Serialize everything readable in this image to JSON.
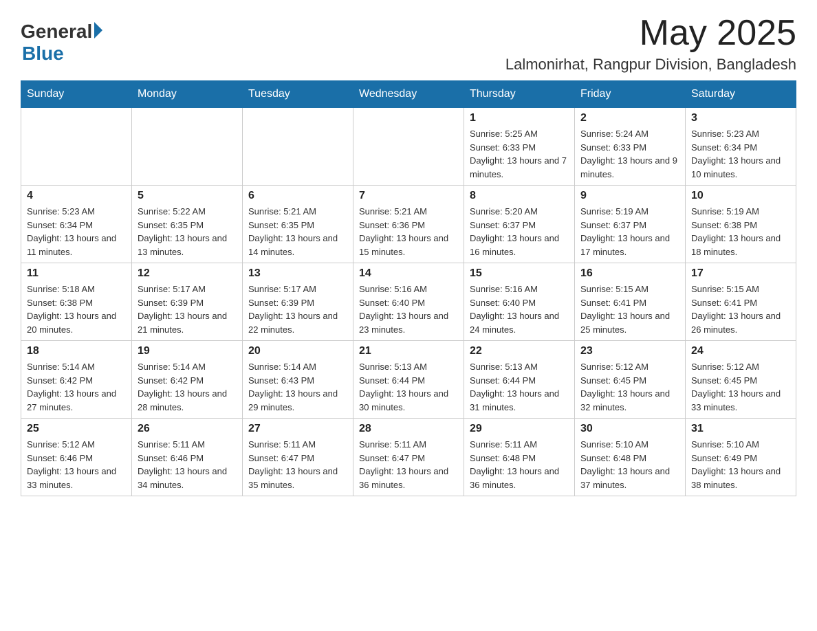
{
  "header": {
    "logo_general": "General",
    "logo_blue": "Blue",
    "month": "May 2025",
    "location": "Lalmonirhat, Rangpur Division, Bangladesh"
  },
  "weekdays": [
    "Sunday",
    "Monday",
    "Tuesday",
    "Wednesday",
    "Thursday",
    "Friday",
    "Saturday"
  ],
  "weeks": [
    [
      {
        "day": "",
        "info": ""
      },
      {
        "day": "",
        "info": ""
      },
      {
        "day": "",
        "info": ""
      },
      {
        "day": "",
        "info": ""
      },
      {
        "day": "1",
        "info": "Sunrise: 5:25 AM\nSunset: 6:33 PM\nDaylight: 13 hours and 7 minutes."
      },
      {
        "day": "2",
        "info": "Sunrise: 5:24 AM\nSunset: 6:33 PM\nDaylight: 13 hours and 9 minutes."
      },
      {
        "day": "3",
        "info": "Sunrise: 5:23 AM\nSunset: 6:34 PM\nDaylight: 13 hours and 10 minutes."
      }
    ],
    [
      {
        "day": "4",
        "info": "Sunrise: 5:23 AM\nSunset: 6:34 PM\nDaylight: 13 hours and 11 minutes."
      },
      {
        "day": "5",
        "info": "Sunrise: 5:22 AM\nSunset: 6:35 PM\nDaylight: 13 hours and 13 minutes."
      },
      {
        "day": "6",
        "info": "Sunrise: 5:21 AM\nSunset: 6:35 PM\nDaylight: 13 hours and 14 minutes."
      },
      {
        "day": "7",
        "info": "Sunrise: 5:21 AM\nSunset: 6:36 PM\nDaylight: 13 hours and 15 minutes."
      },
      {
        "day": "8",
        "info": "Sunrise: 5:20 AM\nSunset: 6:37 PM\nDaylight: 13 hours and 16 minutes."
      },
      {
        "day": "9",
        "info": "Sunrise: 5:19 AM\nSunset: 6:37 PM\nDaylight: 13 hours and 17 minutes."
      },
      {
        "day": "10",
        "info": "Sunrise: 5:19 AM\nSunset: 6:38 PM\nDaylight: 13 hours and 18 minutes."
      }
    ],
    [
      {
        "day": "11",
        "info": "Sunrise: 5:18 AM\nSunset: 6:38 PM\nDaylight: 13 hours and 20 minutes."
      },
      {
        "day": "12",
        "info": "Sunrise: 5:17 AM\nSunset: 6:39 PM\nDaylight: 13 hours and 21 minutes."
      },
      {
        "day": "13",
        "info": "Sunrise: 5:17 AM\nSunset: 6:39 PM\nDaylight: 13 hours and 22 minutes."
      },
      {
        "day": "14",
        "info": "Sunrise: 5:16 AM\nSunset: 6:40 PM\nDaylight: 13 hours and 23 minutes."
      },
      {
        "day": "15",
        "info": "Sunrise: 5:16 AM\nSunset: 6:40 PM\nDaylight: 13 hours and 24 minutes."
      },
      {
        "day": "16",
        "info": "Sunrise: 5:15 AM\nSunset: 6:41 PM\nDaylight: 13 hours and 25 minutes."
      },
      {
        "day": "17",
        "info": "Sunrise: 5:15 AM\nSunset: 6:41 PM\nDaylight: 13 hours and 26 minutes."
      }
    ],
    [
      {
        "day": "18",
        "info": "Sunrise: 5:14 AM\nSunset: 6:42 PM\nDaylight: 13 hours and 27 minutes."
      },
      {
        "day": "19",
        "info": "Sunrise: 5:14 AM\nSunset: 6:42 PM\nDaylight: 13 hours and 28 minutes."
      },
      {
        "day": "20",
        "info": "Sunrise: 5:14 AM\nSunset: 6:43 PM\nDaylight: 13 hours and 29 minutes."
      },
      {
        "day": "21",
        "info": "Sunrise: 5:13 AM\nSunset: 6:44 PM\nDaylight: 13 hours and 30 minutes."
      },
      {
        "day": "22",
        "info": "Sunrise: 5:13 AM\nSunset: 6:44 PM\nDaylight: 13 hours and 31 minutes."
      },
      {
        "day": "23",
        "info": "Sunrise: 5:12 AM\nSunset: 6:45 PM\nDaylight: 13 hours and 32 minutes."
      },
      {
        "day": "24",
        "info": "Sunrise: 5:12 AM\nSunset: 6:45 PM\nDaylight: 13 hours and 33 minutes."
      }
    ],
    [
      {
        "day": "25",
        "info": "Sunrise: 5:12 AM\nSunset: 6:46 PM\nDaylight: 13 hours and 33 minutes."
      },
      {
        "day": "26",
        "info": "Sunrise: 5:11 AM\nSunset: 6:46 PM\nDaylight: 13 hours and 34 minutes."
      },
      {
        "day": "27",
        "info": "Sunrise: 5:11 AM\nSunset: 6:47 PM\nDaylight: 13 hours and 35 minutes."
      },
      {
        "day": "28",
        "info": "Sunrise: 5:11 AM\nSunset: 6:47 PM\nDaylight: 13 hours and 36 minutes."
      },
      {
        "day": "29",
        "info": "Sunrise: 5:11 AM\nSunset: 6:48 PM\nDaylight: 13 hours and 36 minutes."
      },
      {
        "day": "30",
        "info": "Sunrise: 5:10 AM\nSunset: 6:48 PM\nDaylight: 13 hours and 37 minutes."
      },
      {
        "day": "31",
        "info": "Sunrise: 5:10 AM\nSunset: 6:49 PM\nDaylight: 13 hours and 38 minutes."
      }
    ]
  ]
}
